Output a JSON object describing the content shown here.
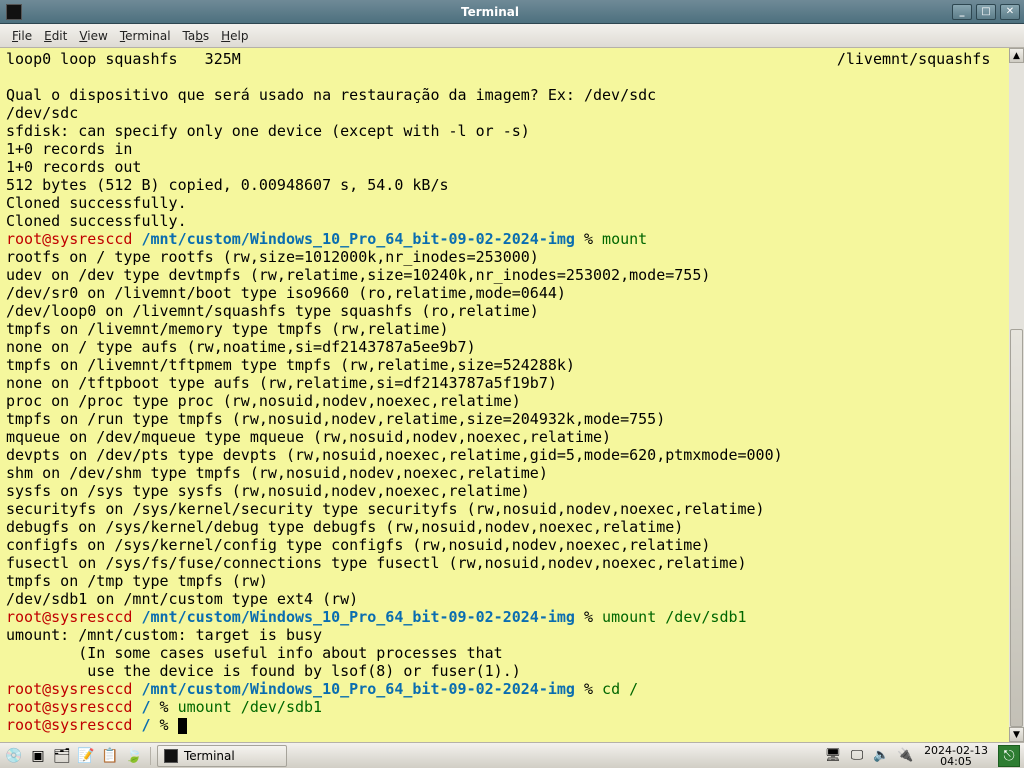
{
  "window": {
    "title": "Terminal",
    "menus": [
      "File",
      "Edit",
      "View",
      "Terminal",
      "Tabs",
      "Help"
    ]
  },
  "terminal": {
    "top_left": "loop0 loop squashfs   325M",
    "top_right": "/livemnt/squashfs",
    "prompt_user": "root@sysresccd",
    "paths": {
      "img": "/mnt/custom/Windows_10_Pro_64_bit-09-02-2024-img",
      "root": "/"
    },
    "commands": {
      "mount": "mount",
      "umount_sdb1": "umount /dev/sdb1",
      "cd_root": "cd /",
      "umount_sdb1b": "umount /dev/sdb1"
    },
    "block1": "Qual o dispositivo que será usado na restauração da imagem? Ex: /dev/sdc\n/dev/sdc\nsfdisk: can specify only one device (except with -l or -s)\n1+0 records in\n1+0 records out\n512 bytes (512 B) copied, 0.00948607 s, 54.0 kB/s\nCloned successfully.\nCloned successfully.",
    "mount_output": "rootfs on / type rootfs (rw,size=1012000k,nr_inodes=253000)\nudev on /dev type devtmpfs (rw,relatime,size=10240k,nr_inodes=253002,mode=755)\n/dev/sr0 on /livemnt/boot type iso9660 (ro,relatime,mode=0644)\n/dev/loop0 on /livemnt/squashfs type squashfs (ro,relatime)\ntmpfs on /livemnt/memory type tmpfs (rw,relatime)\nnone on / type aufs (rw,noatime,si=df2143787a5ee9b7)\ntmpfs on /livemnt/tftpmem type tmpfs (rw,relatime,size=524288k)\nnone on /tftpboot type aufs (rw,relatime,si=df2143787a5f19b7)\nproc on /proc type proc (rw,nosuid,nodev,noexec,relatime)\ntmpfs on /run type tmpfs (rw,nosuid,nodev,relatime,size=204932k,mode=755)\nmqueue on /dev/mqueue type mqueue (rw,nosuid,nodev,noexec,relatime)\ndevpts on /dev/pts type devpts (rw,nosuid,noexec,relatime,gid=5,mode=620,ptmxmode=000)\nshm on /dev/shm type tmpfs (rw,nosuid,nodev,noexec,relatime)\nsysfs on /sys type sysfs (rw,nosuid,nodev,noexec,relatime)\nsecurityfs on /sys/kernel/security type securityfs (rw,nosuid,nodev,noexec,relatime)\ndebugfs on /sys/kernel/debug type debugfs (rw,nosuid,nodev,noexec,relatime)\nconfigfs on /sys/kernel/config type configfs (rw,nosuid,nodev,noexec,relatime)\nfusectl on /sys/fs/fuse/connections type fusectl (rw,nosuid,nodev,noexec,relatime)\ntmpfs on /tmp type tmpfs (rw)\n/dev/sdb1 on /mnt/custom type ext4 (rw)",
    "umount_err": "umount: /mnt/custom: target is busy\n        (In some cases useful info about processes that\n         use the device is found by lsof(8) or fuser(1).)",
    "pct": "%"
  },
  "taskbar": {
    "task_label": "Terminal",
    "clock_date": "2024-02-13",
    "clock_time": "04:05"
  },
  "icons": {
    "disc": "💿",
    "term": "▣",
    "files": "🗂",
    "editor": "📝",
    "note": "📋",
    "leaf": "🍃",
    "screens": "🖥",
    "display": "🖵",
    "volume": "🔈",
    "battery": "🔌",
    "exit": "⎋"
  }
}
